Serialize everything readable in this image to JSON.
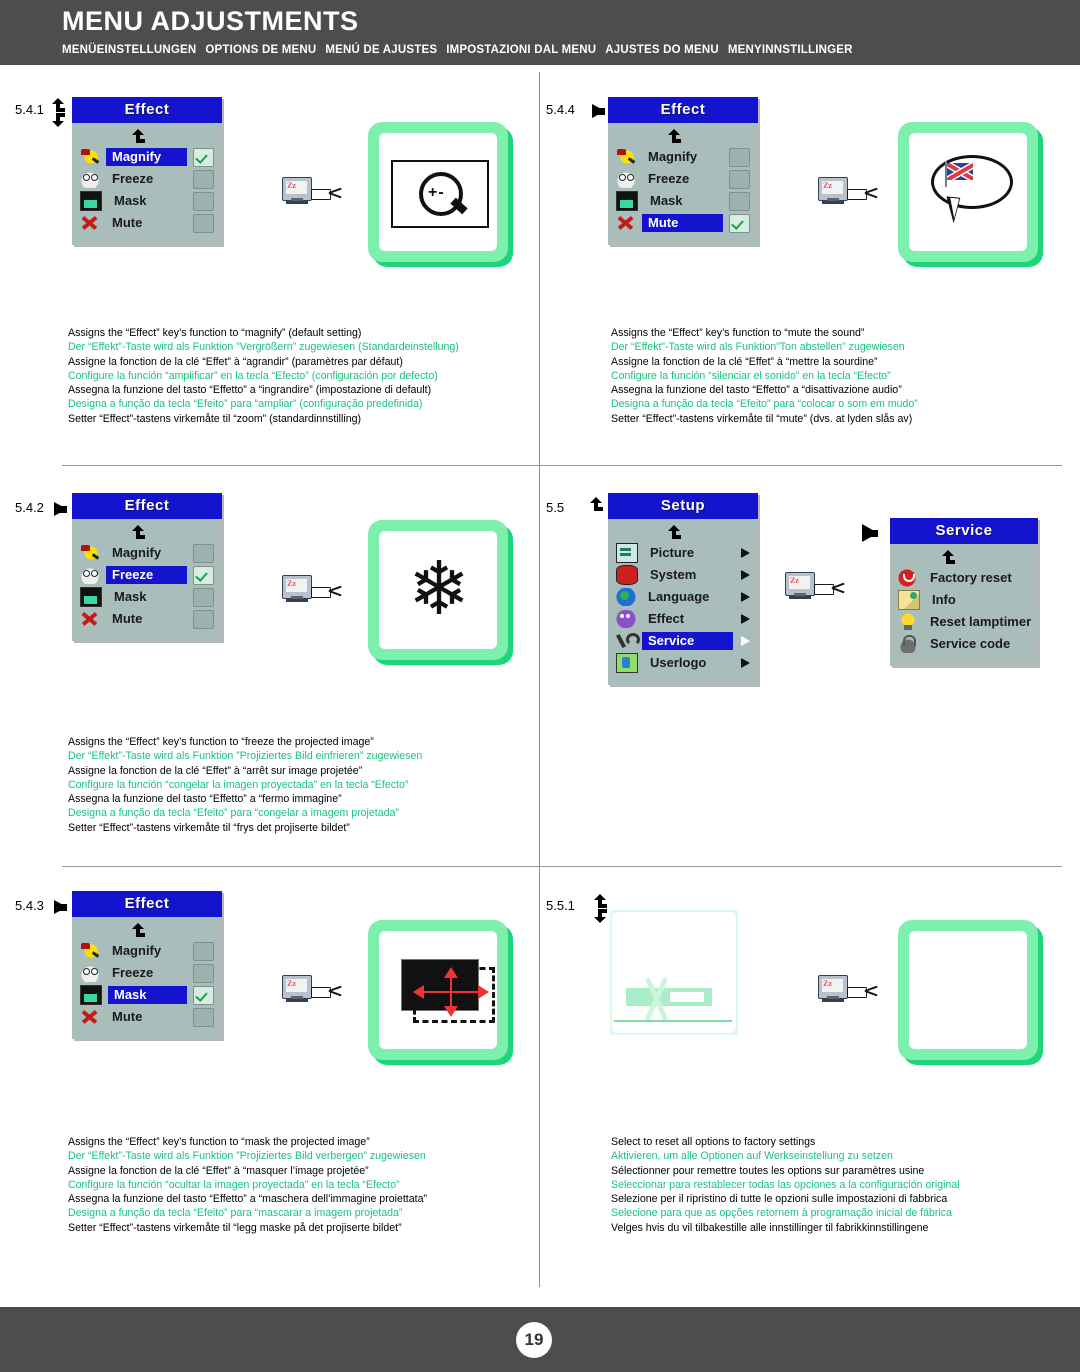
{
  "header": {
    "title": "MENU ADJUSTMENTS",
    "subtitles": [
      "MENÜEINSTELLUNGEN",
      "OPTIONS DE MENU",
      "MENÚ DE AJUSTES",
      "IMPOSTAZIONI DAL MENU",
      "AJUSTES DO MENU",
      "MENYINNSTILLINGER"
    ]
  },
  "footer": {
    "page_number": "19"
  },
  "colors": {
    "header_bg": "#4d4d4d",
    "osd_title_bg": "#1414cf",
    "osd_body_bg": "#a9bdbb",
    "highlight_bg": "#1414cf",
    "green_text": "#19c37d",
    "card_green": "#7ef0ad",
    "card_shadow": "#1fd47a"
  },
  "sections": [
    {
      "id": "5.4.1",
      "step_label": "5.4.1",
      "marker": "up-down-hook",
      "menu": {
        "title": "Effect",
        "back_icon": "back-arrow-icon",
        "items": [
          {
            "label": "Magnify",
            "icon": "magnify-icon",
            "selected": true,
            "checked": true
          },
          {
            "label": "Freeze",
            "icon": "freeze-icon",
            "selected": false,
            "checked": false
          },
          {
            "label": "Mask",
            "icon": "mask-icon",
            "selected": false,
            "checked": false
          },
          {
            "label": "Mute",
            "icon": "mute-icon",
            "selected": false,
            "checked": false
          }
        ]
      },
      "illustration": "magnifier-in-frame",
      "captions": [
        {
          "lang": "en",
          "text": "Assigns the “Effect” key’s function to “magnify” (default setting)",
          "green": false
        },
        {
          "lang": "de",
          "text": "Der “Effekt”-Taste wird als Funktion ”Vergrößern” zugewiesen (Standardeinstellung)",
          "green": true
        },
        {
          "lang": "fr",
          "text": "Assigne la fonction de la clé “Effet” à “agrandir” (paramètres par défaut)",
          "green": false
        },
        {
          "lang": "es",
          "text": "Configure la función “amplificar” en la tecla “Efecto” (configuración por defecto)",
          "green": true
        },
        {
          "lang": "it",
          "text": "Assegna la funzione del tasto “Effetto” a “ingrandire” (impostazione di default)",
          "green": false
        },
        {
          "lang": "pt",
          "text": "Designa a função da tecla “Efeito” para “ampliar” (configuração predefinida)",
          "green": true
        },
        {
          "lang": "no",
          "text": "Setter “Effect”-tastens virkemåte til “zoom” (standardinnstilling)",
          "green": false
        }
      ]
    },
    {
      "id": "5.4.4",
      "step_label": "5.4.4",
      "marker": "right-arrow",
      "menu": {
        "title": "Effect",
        "back_icon": "back-arrow-icon",
        "items": [
          {
            "label": "Magnify",
            "icon": "magnify-icon",
            "selected": false,
            "checked": false
          },
          {
            "label": "Freeze",
            "icon": "freeze-icon",
            "selected": false,
            "checked": false
          },
          {
            "label": "Mask",
            "icon": "mask-icon",
            "selected": false,
            "checked": false
          },
          {
            "label": "Mute",
            "icon": "mute-icon",
            "selected": true,
            "checked": true
          }
        ]
      },
      "illustration": "speech-bubble-flag",
      "captions": [
        {
          "lang": "en",
          "text": "Assigns the “Effect” key’s function to “mute the sound”",
          "green": false
        },
        {
          "lang": "de",
          "text": "Der “Effekt”-Taste wird als Funktion”Ton abstellen” zugewiesen",
          "green": true
        },
        {
          "lang": "fr",
          "text": "Assigne la fonction de la clé “Effet” à “mettre la sourdine”",
          "green": false
        },
        {
          "lang": "es",
          "text": "Configure la función “silenciar el sonido” en la tecla “Efecto”",
          "green": true
        },
        {
          "lang": "it",
          "text": "Assegna la funzione del tasto “Effetto” a “disattivazione audio”",
          "green": false
        },
        {
          "lang": "pt",
          "text": "Designa a função da tecla “Efeito” para “colocar o som em mudo”",
          "green": true
        },
        {
          "lang": "no",
          "text": "Setter “Effect”-tastens virkemåte til “mute” (dvs. at lyden slås av)",
          "green": false
        }
      ]
    },
    {
      "id": "5.4.2",
      "step_label": "5.4.2",
      "marker": "right-arrow",
      "menu": {
        "title": "Effect",
        "back_icon": "back-arrow-icon",
        "items": [
          {
            "label": "Magnify",
            "icon": "magnify-icon",
            "selected": false,
            "checked": false
          },
          {
            "label": "Freeze",
            "icon": "freeze-icon",
            "selected": true,
            "checked": true
          },
          {
            "label": "Mask",
            "icon": "mask-icon",
            "selected": false,
            "checked": false
          },
          {
            "label": "Mute",
            "icon": "mute-icon",
            "selected": false,
            "checked": false
          }
        ]
      },
      "illustration": "snowflake",
      "captions": [
        {
          "lang": "en",
          "text": "Assigns the “Effect” key’s function to “freeze the projected image”",
          "green": false
        },
        {
          "lang": "de",
          "text": "Der “Effekt”-Taste wird als Funktion ”Projiziertes Bild einfrieren” zugewiesen",
          "green": true
        },
        {
          "lang": "fr",
          "text": "Assigne la fonction de la clé “Effet” à “arrêt sur image projetée”",
          "green": false
        },
        {
          "lang": "es",
          "text": "Configure la función “congelar la imagen proyectada” en la tecla “Efecto”",
          "green": true
        },
        {
          "lang": "it",
          "text": "Assegna la funzione del tasto “Effetto” a “fermo immagine”",
          "green": false
        },
        {
          "lang": "pt",
          "text": "Designa a função da tecla “Efeito” para “congelar a imagem projetada”",
          "green": true
        },
        {
          "lang": "no",
          "text": "Setter “Effect”-tastens virkemåte til “frys det projiserte bildet”",
          "green": false
        }
      ]
    },
    {
      "id": "5.5",
      "step_label": "5.5",
      "marker": "up-hook",
      "menu": {
        "title": "Setup",
        "back_icon": "back-arrow-icon",
        "items": [
          {
            "label": "Picture",
            "icon": "picture-icon",
            "selected": false,
            "submenu": true
          },
          {
            "label": "System",
            "icon": "system-icon",
            "selected": false,
            "submenu": true
          },
          {
            "label": "Language",
            "icon": "language-icon",
            "selected": false,
            "submenu": true
          },
          {
            "label": "Effect",
            "icon": "effect-icon",
            "selected": false,
            "submenu": true
          },
          {
            "label": "Service",
            "icon": "wrench-icon",
            "selected": true,
            "submenu": true
          },
          {
            "label": "Userlogo",
            "icon": "userlogo-icon",
            "selected": false,
            "submenu": true
          }
        ]
      },
      "submenu": {
        "title": "Service",
        "back_icon": "back-arrow-icon",
        "items": [
          {
            "label": "Factory reset",
            "icon": "factory-reset-icon"
          },
          {
            "label": "Info",
            "icon": "info-icon"
          },
          {
            "label": "Reset lamptimer",
            "icon": "lamp-icon"
          },
          {
            "label": "Service code",
            "icon": "lock-icon"
          }
        ]
      },
      "captions": []
    },
    {
      "id": "5.4.3",
      "step_label": "5.4.3",
      "marker": "right-arrow",
      "menu": {
        "title": "Effect",
        "back_icon": "back-arrow-icon",
        "items": [
          {
            "label": "Magnify",
            "icon": "magnify-icon",
            "selected": false,
            "checked": false
          },
          {
            "label": "Freeze",
            "icon": "freeze-icon",
            "selected": false,
            "checked": false
          },
          {
            "label": "Mask",
            "icon": "mask-icon",
            "selected": true,
            "checked": true
          },
          {
            "label": "Mute",
            "icon": "mute-icon",
            "selected": false,
            "checked": false
          }
        ]
      },
      "illustration": "mask-arrows",
      "captions": [
        {
          "lang": "en",
          "text": "Assigns the “Effect” key’s function to “mask the projected image”",
          "green": false
        },
        {
          "lang": "de",
          "text": "Der “Effekt”-Taste wird als Funktion ”Projiziertes Bild verbergen” zugewiesen",
          "green": true
        },
        {
          "lang": "fr",
          "text": "Assigne la fonction de la clé “Effet” à “masquer l’image projetée”",
          "green": false
        },
        {
          "lang": "es",
          "text": "Configure la función “ocultar la imagen proyectada” en la tecla “Efecto”",
          "green": true
        },
        {
          "lang": "it",
          "text": "Assegna la funzione del tasto “Effetto” a “maschera dell’immagine proiettata”",
          "green": false
        },
        {
          "lang": "pt",
          "text": "Designa a função da tecla “Efeito” para “mascarar a imagem projetada”",
          "green": true
        },
        {
          "lang": "no",
          "text": "Setter “Effect”-tastens virkemåte til “legg maske på det projiserte bildet”",
          "green": false
        }
      ]
    },
    {
      "id": "5.5.1",
      "step_label": "5.5.1",
      "marker": "up-down-hook",
      "illustration": "factory-reset-faded",
      "captions": [
        {
          "lang": "en",
          "text": "Select to reset all options to factory settings",
          "green": false
        },
        {
          "lang": "de",
          "text": "Aktivieren, um alle Optionen auf Werkseinstellung zu setzen",
          "green": true
        },
        {
          "lang": "fr",
          "text": "Sélectionner pour remettre toutes les options sur paramètres usine",
          "green": false
        },
        {
          "lang": "es",
          "text": "Seleccionar para restablecer todas las opciones a la configuración original",
          "green": true
        },
        {
          "lang": "it",
          "text": "Selezione per il ripristino di tutte le opzioni sulle impostazioni di fabbrica",
          "green": false
        },
        {
          "lang": "pt",
          "text": "Selecione para que as opções retornem à programação inicial de fábrica",
          "green": true
        },
        {
          "lang": "no",
          "text": "Velges hvis du vil tilbakestille alle innstillinger til fabrikkinnstillingene",
          "green": false
        }
      ]
    }
  ]
}
